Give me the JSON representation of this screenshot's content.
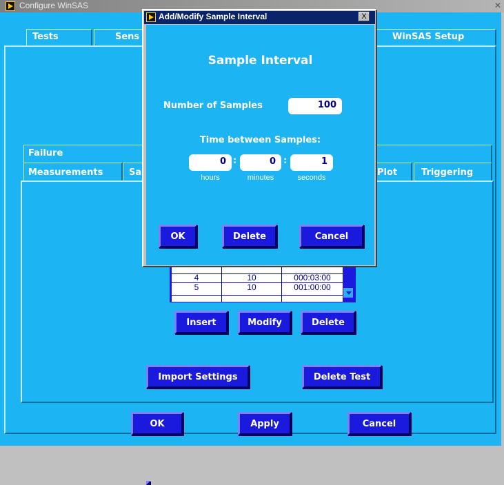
{
  "window": {
    "title": "Configure WinSAS"
  },
  "top_tabs": [
    "Tests",
    "Sens",
    "WinSAS Setup"
  ],
  "sub_tabs": {
    "row1": [
      "Failure"
    ],
    "row2": [
      "Measurements",
      "Sa",
      "Plot",
      "Triggering"
    ]
  },
  "table": {
    "rows": [
      {
        "n": "4",
        "samples": "10",
        "time": "000:03:00"
      },
      {
        "n": "5",
        "samples": "10",
        "time": "001:00:00"
      }
    ]
  },
  "table_buttons": {
    "insert": "Insert",
    "modify": "Modify",
    "delete": "Delete"
  },
  "panel_buttons": {
    "import": "Import Settings",
    "delete_test": "Delete Test"
  },
  "bottom_buttons": {
    "ok": "OK",
    "apply": "Apply",
    "cancel": "Cancel"
  },
  "dialog": {
    "title": "Add/Modify Sample Interval",
    "close": "X",
    "heading": "Sample Interval",
    "num_samples_label": "Number of Samples",
    "num_samples": "100",
    "time_label": "Time between Samples:",
    "hours": "0",
    "minutes": "0",
    "seconds": "1",
    "sep": ":",
    "hours_label": "hours",
    "minutes_label": "minutes",
    "seconds_label": "seconds",
    "buttons": {
      "ok": "OK",
      "delete": "Delete",
      "cancel": "Cancel"
    }
  },
  "colors": {
    "panel": "#1cb4f2",
    "button": "#1a1adf",
    "title_active": "#0a246a"
  },
  "icons": {
    "app": "labview-run-arrow-icon",
    "scroll": "scroll-down-arrow-icon"
  }
}
